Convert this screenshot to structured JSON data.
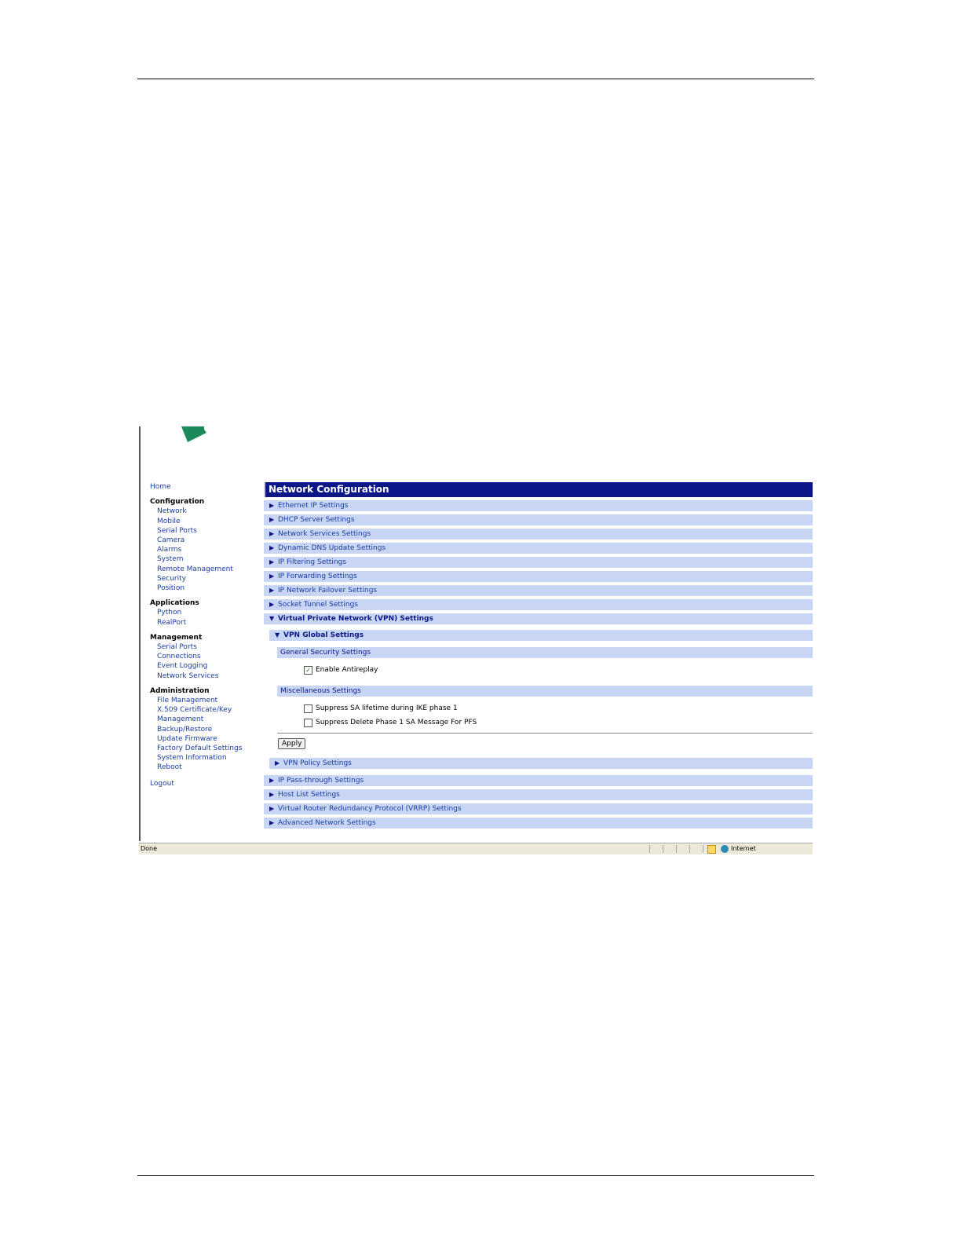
{
  "sidebar": {
    "home": "Home",
    "configuration": {
      "title": "Configuration",
      "items": [
        "Network",
        "Mobile",
        "Serial Ports",
        "Camera",
        "Alarms",
        "System",
        "Remote Management",
        "Security",
        "Position"
      ]
    },
    "applications": {
      "title": "Applications",
      "items": [
        "Python",
        "RealPort"
      ]
    },
    "management": {
      "title": "Management",
      "items": [
        "Serial Ports",
        "Connections",
        "Event Logging",
        "Network Services"
      ]
    },
    "administration": {
      "title": "Administration",
      "items": [
        "File Management",
        "X.509 Certificate/Key",
        "Management",
        "Backup/Restore",
        "Update Firmware",
        "Factory Default Settings",
        "System Information",
        "Reboot"
      ]
    },
    "logout": "Logout"
  },
  "main": {
    "title": "Network Configuration",
    "sections_top": [
      "Ethernet IP Settings",
      "DHCP Server Settings",
      "Network Services Settings",
      "Dynamic DNS Update Settings",
      "IP Filtering Settings",
      "IP Forwarding Settings",
      "IP Network Failover Settings",
      "Socket Tunnel Settings"
    ],
    "vpn_section": "Virtual Private Network (VPN) Settings",
    "vpn_global": "VPN Global Settings",
    "general_security": "General Security Settings",
    "enable_antireplay": {
      "label": "Enable Antireplay",
      "checked": true
    },
    "misc_settings": "Miscellaneous Settings",
    "suppress_sa": {
      "label": "Suppress SA lifetime during IKE phase 1",
      "checked": false
    },
    "suppress_delete": {
      "label": "Suppress Delete Phase 1 SA Message For PFS",
      "checked": false
    },
    "apply_label": "Apply",
    "vpn_policy": "VPN Policy Settings",
    "sections_bottom": [
      "IP Pass-through Settings",
      "Host List Settings",
      "Virtual Router Redundancy Protocol (VRRP) Settings",
      "Advanced Network Settings"
    ]
  },
  "statusbar": {
    "text": "Done",
    "zone": "Internet"
  },
  "icons": {
    "collapsed": "triangle-right",
    "expanded": "triangle-down"
  },
  "colors": {
    "title_bar": "#0b1687",
    "section_row": "#c9d5f5",
    "link": "#1a3ea0"
  }
}
